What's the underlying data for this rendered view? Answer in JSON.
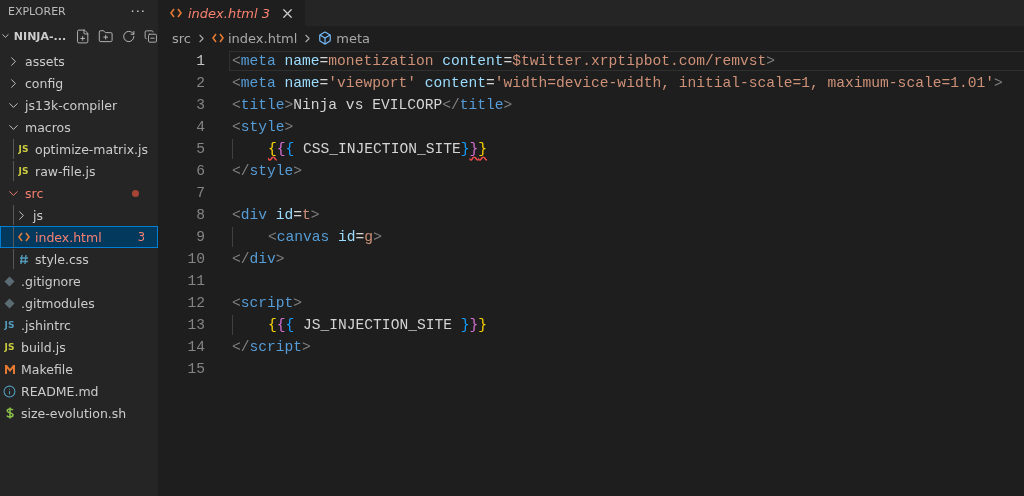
{
  "explorer": {
    "title": "EXPLORER",
    "more": "···",
    "project": {
      "name": "NINJA-...",
      "expanded": true
    },
    "tree": [
      {
        "name": "assets",
        "kind": "folder",
        "expanded": false,
        "selected": false,
        "error": false
      },
      {
        "name": "config",
        "kind": "folder",
        "expanded": false,
        "selected": false,
        "error": false
      },
      {
        "name": "js13k-compiler",
        "kind": "folder",
        "expanded": true,
        "selected": false,
        "error": false
      },
      {
        "name": "macros",
        "kind": "folder",
        "expanded": true,
        "selected": false,
        "error": false,
        "children": [
          {
            "name": "optimize-matrix.js",
            "kind": "js",
            "icon_text": "JS",
            "selected": false,
            "error": false
          },
          {
            "name": "raw-file.js",
            "kind": "js",
            "icon_text": "JS",
            "selected": false,
            "error": false
          }
        ]
      },
      {
        "name": "src",
        "kind": "folder",
        "expanded": true,
        "selected": false,
        "error": true,
        "modified": true,
        "children": [
          {
            "name": "js",
            "kind": "folder",
            "expanded": false,
            "selected": false,
            "error": false
          },
          {
            "name": "index.html",
            "kind": "html",
            "selected": true,
            "error": true,
            "badge": "3"
          },
          {
            "name": "style.css",
            "kind": "css",
            "selected": false,
            "error": false
          }
        ]
      },
      {
        "name": ".gitignore",
        "kind": "git",
        "selected": false,
        "error": false
      },
      {
        "name": ".gitmodules",
        "kind": "git",
        "selected": false,
        "error": false
      },
      {
        "name": ".jshintrc",
        "kind": "config",
        "icon_text": "JS",
        "selected": false,
        "error": false
      },
      {
        "name": "build.js",
        "kind": "js",
        "icon_text": "JS",
        "selected": false,
        "error": false
      },
      {
        "name": "Makefile",
        "kind": "make",
        "selected": false,
        "error": false
      },
      {
        "name": "README.md",
        "kind": "info",
        "selected": false,
        "error": false
      },
      {
        "name": "size-evolution.sh",
        "kind": "shell",
        "selected": false,
        "error": false
      }
    ]
  },
  "tabs": [
    {
      "label": "index.html",
      "badge": "3",
      "selected": true,
      "preview": true,
      "error": true
    }
  ],
  "breadcrumbs": [
    {
      "label": "src",
      "kind": "folder"
    },
    {
      "label": "index.html",
      "kind": "html"
    },
    {
      "label": "meta",
      "kind": "symbol"
    }
  ],
  "code": {
    "lines": [
      {
        "number": "1",
        "current": true,
        "indent": false,
        "tokens": [
          {
            "kind": "punct",
            "text": "<"
          },
          {
            "kind": "tag",
            "text": "meta"
          },
          {
            "kind": "attr",
            "text": " name"
          },
          {
            "kind": "text",
            "text": "="
          },
          {
            "kind": "str",
            "text": "monetization"
          },
          {
            "kind": "attr",
            "text": " content"
          },
          {
            "kind": "text",
            "text": "="
          },
          {
            "kind": "str",
            "text": "$twitter.xrptipbot.com/remvst"
          },
          {
            "kind": "punct",
            "text": ">"
          }
        ]
      },
      {
        "number": "2",
        "current": false,
        "indent": false,
        "tokens": [
          {
            "kind": "punct",
            "text": "<"
          },
          {
            "kind": "tag",
            "text": "meta"
          },
          {
            "kind": "attr",
            "text": " name"
          },
          {
            "kind": "text",
            "text": "="
          },
          {
            "kind": "str",
            "text": "'viewport'"
          },
          {
            "kind": "attr",
            "text": " content"
          },
          {
            "kind": "text",
            "text": "="
          },
          {
            "kind": "str",
            "text": "'width=device-width, initial-scale=1, maximum-scale=1.01'"
          },
          {
            "kind": "punct",
            "text": ">"
          }
        ]
      },
      {
        "number": "3",
        "current": false,
        "indent": false,
        "tokens": [
          {
            "kind": "punct",
            "text": "<"
          },
          {
            "kind": "tag",
            "text": "title"
          },
          {
            "kind": "punct",
            "text": ">"
          },
          {
            "kind": "text",
            "text": "Ninja vs EVILCORP"
          },
          {
            "kind": "punct",
            "text": "</"
          },
          {
            "kind": "tag",
            "text": "title"
          },
          {
            "kind": "punct",
            "text": ">"
          }
        ]
      },
      {
        "number": "4",
        "current": false,
        "indent": false,
        "tokens": [
          {
            "kind": "punct",
            "text": "<"
          },
          {
            "kind": "tag",
            "text": "style"
          },
          {
            "kind": "punct",
            "text": ">"
          }
        ]
      },
      {
        "number": "5",
        "current": false,
        "indent": true,
        "tokens": [
          {
            "kind": "brace1",
            "text": "{",
            "error": true
          },
          {
            "kind": "brace2",
            "text": "{",
            "error": false
          },
          {
            "kind": "brace3",
            "text": "{",
            "error": false
          },
          {
            "kind": "text",
            "text": " CSS_INJECTION_SITE"
          },
          {
            "kind": "brace3",
            "text": "}",
            "error": false
          },
          {
            "kind": "brace2",
            "text": "}",
            "error": true
          },
          {
            "kind": "brace1",
            "text": "}",
            "error": true
          }
        ]
      },
      {
        "number": "6",
        "current": false,
        "indent": false,
        "tokens": [
          {
            "kind": "punct",
            "text": "</"
          },
          {
            "kind": "tag",
            "text": "style"
          },
          {
            "kind": "punct",
            "text": ">"
          }
        ]
      },
      {
        "number": "7",
        "current": false,
        "indent": false
      },
      {
        "number": "8",
        "current": false,
        "indent": false,
        "tokens": [
          {
            "kind": "punct",
            "text": "<"
          },
          {
            "kind": "tag",
            "text": "div"
          },
          {
            "kind": "attr",
            "text": " id"
          },
          {
            "kind": "text",
            "text": "="
          },
          {
            "kind": "str",
            "text": "t"
          },
          {
            "kind": "punct",
            "text": ">"
          }
        ]
      },
      {
        "number": "9",
        "current": false,
        "indent": true,
        "tokens": [
          {
            "kind": "punct",
            "text": "<"
          },
          {
            "kind": "tag",
            "text": "canvas"
          },
          {
            "kind": "attr",
            "text": " id"
          },
          {
            "kind": "text",
            "text": "="
          },
          {
            "kind": "str",
            "text": "g"
          },
          {
            "kind": "punct",
            "text": ">"
          }
        ]
      },
      {
        "number": "10",
        "current": false,
        "indent": false,
        "tokens": [
          {
            "kind": "punct",
            "text": "</"
          },
          {
            "kind": "tag",
            "text": "div"
          },
          {
            "kind": "punct",
            "text": ">"
          }
        ]
      },
      {
        "number": "11",
        "current": false,
        "indent": false
      },
      {
        "number": "12",
        "current": false,
        "indent": false,
        "tokens": [
          {
            "kind": "punct",
            "text": "<"
          },
          {
            "kind": "tag",
            "text": "script"
          },
          {
            "kind": "punct",
            "text": ">"
          }
        ]
      },
      {
        "number": "13",
        "current": false,
        "indent": true,
        "tokens": [
          {
            "kind": "brace1",
            "text": "{",
            "error": false
          },
          {
            "kind": "brace2",
            "text": "{",
            "error": false
          },
          {
            "kind": "brace3",
            "text": "{",
            "error": false
          },
          {
            "kind": "text",
            "text": " JS_INJECTION_SITE "
          },
          {
            "kind": "brace3",
            "text": "}",
            "error": false
          },
          {
            "kind": "brace2",
            "text": "}",
            "error": false
          },
          {
            "kind": "brace1",
            "text": "}",
            "error": false
          }
        ]
      },
      {
        "number": "14",
        "current": false,
        "indent": false,
        "tokens": [
          {
            "kind": "punct",
            "text": "</"
          },
          {
            "kind": "tag",
            "text": "script"
          },
          {
            "kind": "punct",
            "text": ">"
          }
        ]
      },
      {
        "number": "15",
        "current": false,
        "indent": false
      }
    ]
  }
}
